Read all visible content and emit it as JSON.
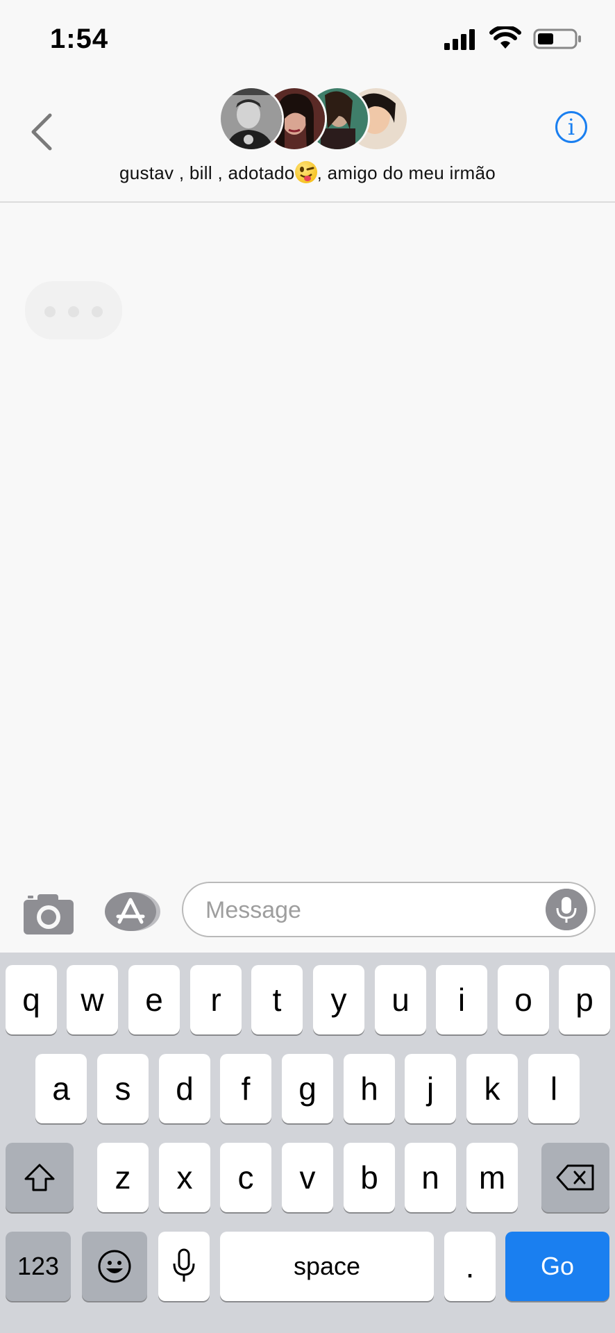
{
  "status": {
    "time": "1:54"
  },
  "header": {
    "title_part1": "gustav , bill , adotado",
    "title_part2": ", amigo do meu irmão",
    "info_label": "i"
  },
  "composer": {
    "placeholder": "Message"
  },
  "keyboard": {
    "row1": [
      "q",
      "w",
      "e",
      "r",
      "t",
      "y",
      "u",
      "i",
      "o",
      "p"
    ],
    "row2": [
      "a",
      "s",
      "d",
      "f",
      "g",
      "h",
      "j",
      "k",
      "l"
    ],
    "row3": [
      "z",
      "x",
      "c",
      "v",
      "b",
      "n",
      "m"
    ],
    "numbers_label": "123",
    "space_label": "space",
    "period_label": ".",
    "go_label": "Go"
  },
  "colors": {
    "accent": "#1a7ff0",
    "background": "#f8f8f8",
    "keyboard": "#d2d4d9"
  }
}
